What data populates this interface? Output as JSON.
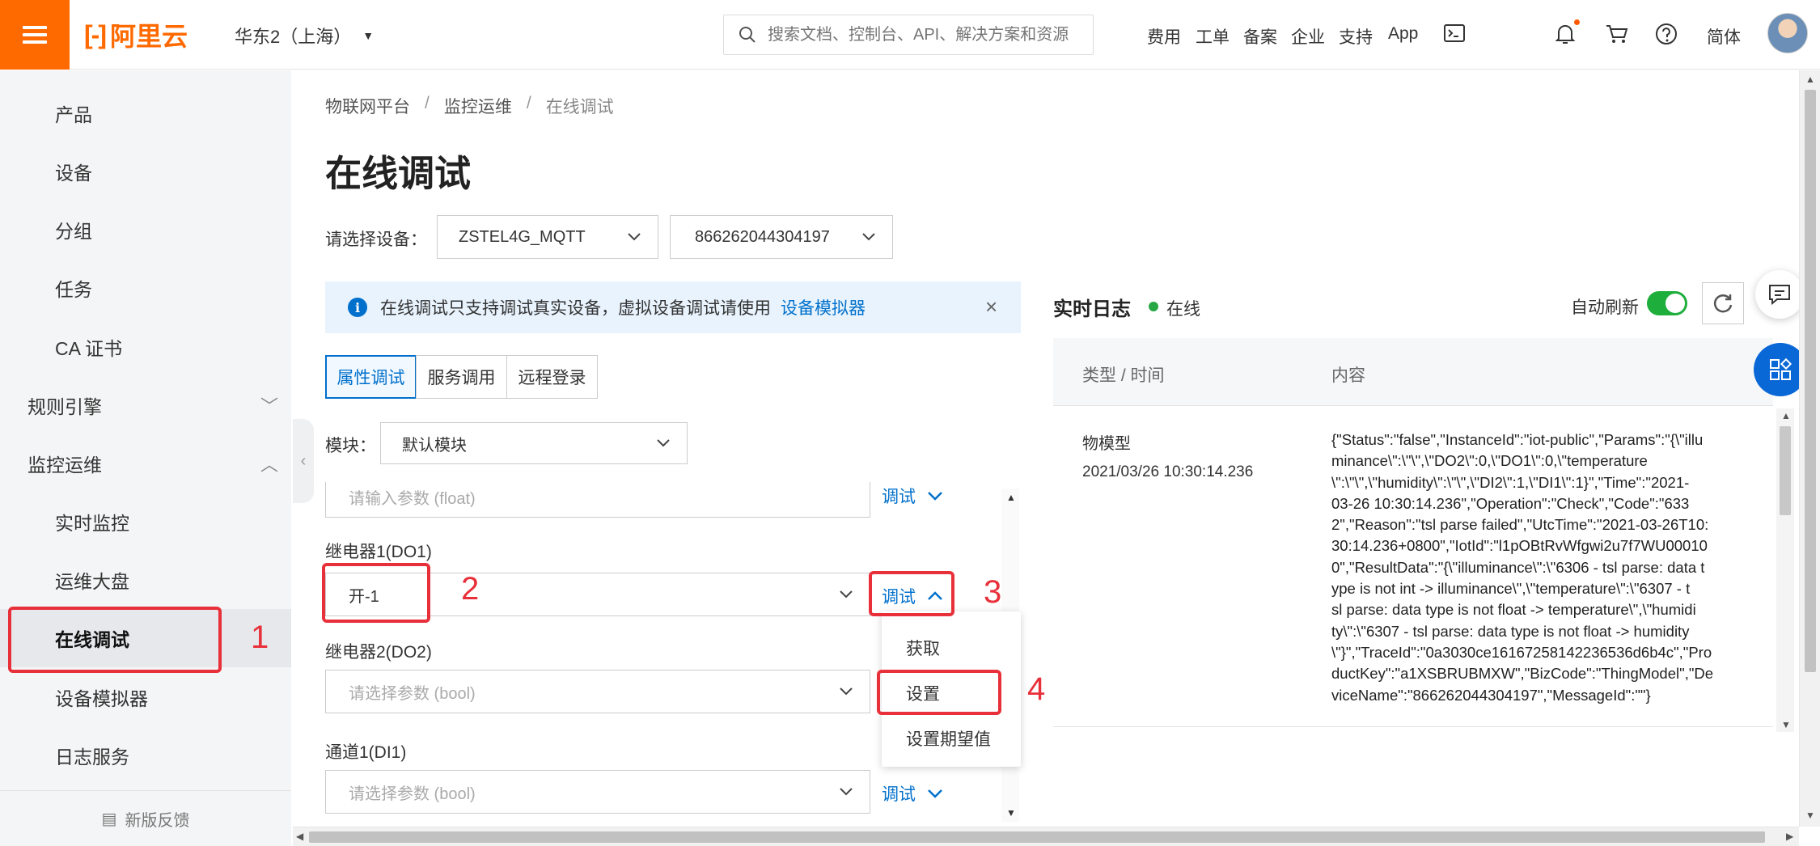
{
  "topbar": {
    "brand": "阿里云",
    "region": "华东2（上海）",
    "search_placeholder": "搜索文档、控制台、API、解决方案和资源",
    "nav": [
      "费用",
      "工单",
      "备案",
      "企业",
      "支持",
      "App"
    ],
    "language": "简体",
    "icons": [
      "menu-icon",
      "terminal-icon",
      "bell-icon",
      "cart-icon",
      "help-icon",
      "search-icon"
    ]
  },
  "sidebar": {
    "items": [
      {
        "label": "产品"
      },
      {
        "label": "设备"
      },
      {
        "label": "分组"
      },
      {
        "label": "任务"
      },
      {
        "label": "CA 证书"
      },
      {
        "label": "规则引擎"
      },
      {
        "label": "监控运维"
      },
      {
        "label": "实时监控"
      },
      {
        "label": "运维大盘"
      },
      {
        "label": "在线调试"
      },
      {
        "label": "设备模拟器"
      },
      {
        "label": "日志服务"
      }
    ],
    "feedback": "新版反馈",
    "active": "在线调试"
  },
  "annotations": [
    "1",
    "2",
    "3",
    "4"
  ],
  "main": {
    "breadcrumb": [
      "物联网平台",
      "/",
      "监控运维",
      "/",
      "在线调试"
    ],
    "title": "在线调试",
    "device_label": "请选择设备：",
    "product_select": "ZSTEL4G_MQTT",
    "device_select": "866262044304197",
    "banner_text": "在线调试只支持调试真实设备，虚拟设备调试请使用",
    "banner_link": "设备模拟器",
    "tabs": [
      "属性调试",
      "服务调用",
      "远程登录"
    ],
    "module_label": "模块：",
    "module_value": "默认模块",
    "fields": [
      {
        "label": "",
        "placeholder": "请输入参数 (float)",
        "debug": "调试"
      },
      {
        "label": "继电器1(DO1)",
        "value": "开-1",
        "debug": "调试"
      },
      {
        "label": "继电器2(DO2)",
        "placeholder": "请选择参数 (bool)",
        "debug": ""
      },
      {
        "label": "通道1(DI1)",
        "placeholder": "请选择参数 (bool)",
        "debug": "调试"
      }
    ],
    "dropdown_menu": [
      "获取",
      "设置",
      "设置期望值"
    ]
  },
  "log": {
    "title": "实时日志",
    "status": "在线",
    "auto_refresh_label": "自动刷新",
    "auto_refresh_on": true,
    "col_type": "类型 / 时间",
    "col_content": "内容",
    "row": {
      "type": "物模型",
      "time": "2021/03/26 10:30:14.236",
      "content_lines": [
        "{\"Status\":\"false\",\"InstanceId\":\"iot-public\",\"Params\":\"{\\\"illu",
        "minance\\\":\\\"\\\",\\\"DO2\\\":0,\\\"DO1\\\":0,\\\"temperature",
        "\\\":\\\"\\\",\\\"humidity\\\":\\\"\\\",\\\"DI2\\\":1,\\\"DI1\\\":1}\",\"Time\":\"2021-",
        "03-26 10:30:14.236\",\"Operation\":\"Check\",\"Code\":\"633",
        "2\",\"Reason\":\"tsl parse failed\",\"UtcTime\":\"2021-03-26T10:",
        "30:14.236+0800\",\"IotId\":\"l1pOBtRvWfgwi2u7f7WU00010",
        "0\",\"ResultData\":\"{\\\"illuminance\\\":\\\"6306 - tsl parse: data t",
        "ype is not int -> illuminance\\\",\\\"temperature\\\":\\\"6307 - t",
        "sl parse: data type is not float -> temperature\\\",\\\"humidi",
        "ty\\\":\\\"6307 - tsl parse: data type is not float -> humidity",
        "\\\"}\",\"TraceId\":\"0a3030ce16167258142236536d6b4c\",\"Pro",
        "ductKey\":\"a1XSBRUBMXW\",\"BizCode\":\"ThingModel\",\"De",
        "viceName\":\"866262044304197\",\"MessageId\":\"\"}"
      ]
    }
  },
  "colors": {
    "brand": "#ff6a00",
    "link": "#0070cc",
    "annotation": "#e8303a",
    "online": "#28a745",
    "toggle": "#1eae3c"
  }
}
